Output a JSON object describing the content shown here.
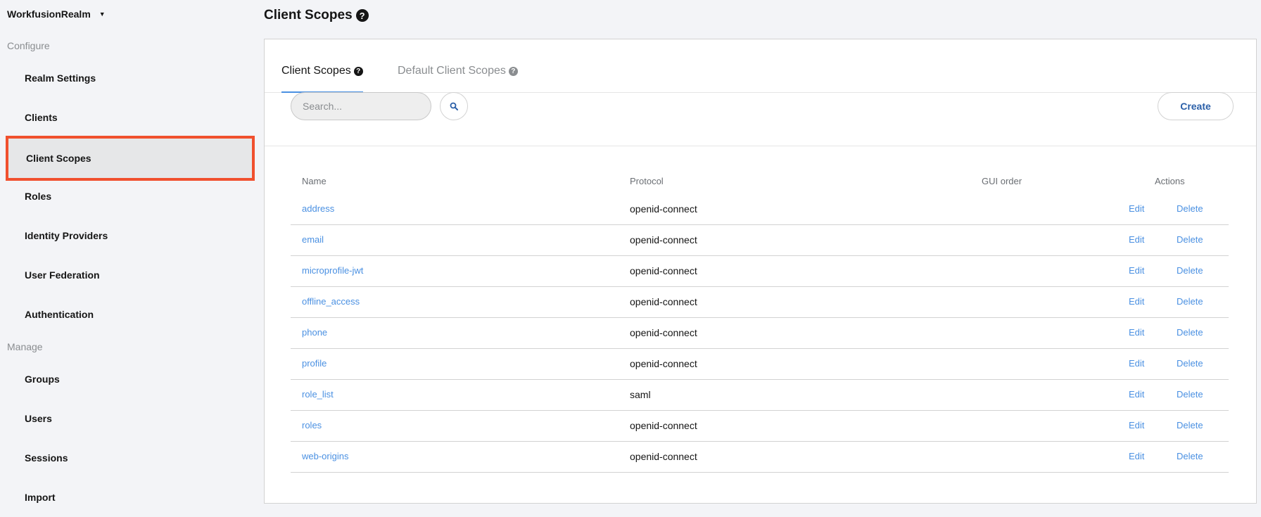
{
  "sidebar": {
    "realm": "WorkfusionRealm",
    "configure_label": "Configure",
    "manage_label": "Manage",
    "configure_items": [
      {
        "label": "Realm Settings"
      },
      {
        "label": "Clients"
      },
      {
        "label": "Client Scopes"
      },
      {
        "label": "Roles"
      },
      {
        "label": "Identity Providers"
      },
      {
        "label": "User Federation"
      },
      {
        "label": "Authentication"
      }
    ],
    "manage_items": [
      {
        "label": "Groups"
      },
      {
        "label": "Users"
      },
      {
        "label": "Sessions"
      },
      {
        "label": "Import"
      }
    ],
    "active_item": "Client Scopes",
    "highlight_color": "#f0502e"
  },
  "header": {
    "title": "Client Scopes"
  },
  "tabs": [
    {
      "label": "Client Scopes",
      "active": true
    },
    {
      "label": "Default Client Scopes",
      "active": false
    }
  ],
  "toolbar": {
    "search_placeholder": "Search...",
    "create_label": "Create"
  },
  "table": {
    "columns": [
      "Name",
      "Protocol",
      "GUI order",
      "Actions"
    ],
    "rows": [
      {
        "name": "address",
        "protocol": "openid-connect",
        "gui_order": "",
        "edit": "Edit",
        "delete": "Delete"
      },
      {
        "name": "email",
        "protocol": "openid-connect",
        "gui_order": "",
        "edit": "Edit",
        "delete": "Delete"
      },
      {
        "name": "microprofile-jwt",
        "protocol": "openid-connect",
        "gui_order": "",
        "edit": "Edit",
        "delete": "Delete"
      },
      {
        "name": "offline_access",
        "protocol": "openid-connect",
        "gui_order": "",
        "edit": "Edit",
        "delete": "Delete"
      },
      {
        "name": "phone",
        "protocol": "openid-connect",
        "gui_order": "",
        "edit": "Edit",
        "delete": "Delete"
      },
      {
        "name": "profile",
        "protocol": "openid-connect",
        "gui_order": "",
        "edit": "Edit",
        "delete": "Delete"
      },
      {
        "name": "role_list",
        "protocol": "saml",
        "gui_order": "",
        "edit": "Edit",
        "delete": "Delete"
      },
      {
        "name": "roles",
        "protocol": "openid-connect",
        "gui_order": "",
        "edit": "Edit",
        "delete": "Delete"
      },
      {
        "name": "web-origins",
        "protocol": "openid-connect",
        "gui_order": "",
        "edit": "Edit",
        "delete": "Delete"
      }
    ]
  },
  "colors": {
    "link": "#4a90e2",
    "create_text": "#2a5fa8"
  },
  "icons": {
    "search": "search-icon",
    "help": "help-circle-icon",
    "caret": "caret-down-icon"
  }
}
